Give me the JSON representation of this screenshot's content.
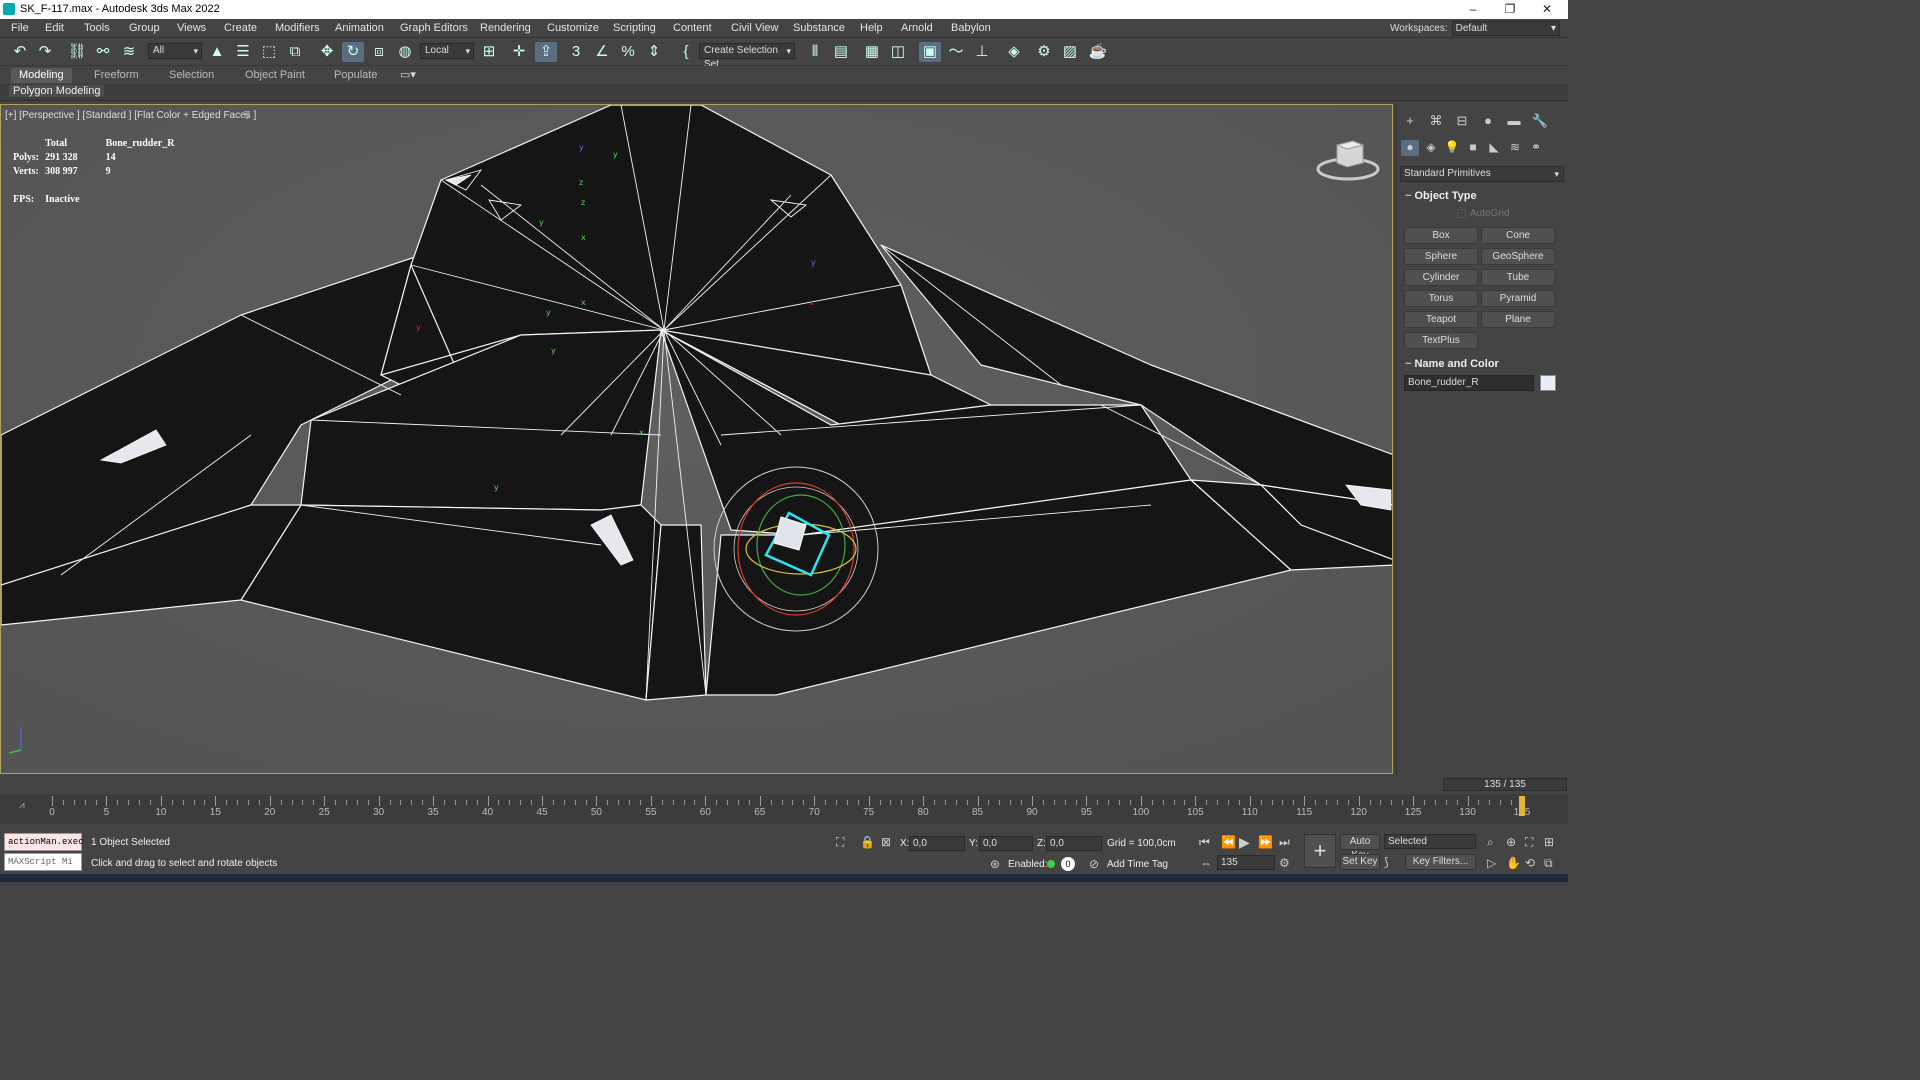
{
  "titlebar": {
    "title": "SK_F-117.max - Autodesk 3ds Max 2022",
    "minimize": "–",
    "restore": "❐",
    "close": "✕"
  },
  "menu": [
    "File",
    "Edit",
    "Tools",
    "Group",
    "Views",
    "Create",
    "Modifiers",
    "Animation",
    "Graph Editors",
    "Rendering",
    "Customize",
    "Scripting",
    "Content",
    "Civil View",
    "Substance",
    "Help",
    "Arnold",
    "Babylon"
  ],
  "workspace": {
    "label": "Workspaces:",
    "value": "Default"
  },
  "toolbar": {
    "filter": "All",
    "coord": "Local",
    "selset": "Create Selection Set"
  },
  "ribbon": {
    "tabs": [
      "Modeling",
      "Freeform",
      "Selection",
      "Object Paint",
      "Populate"
    ],
    "sub": "Polygon Modeling"
  },
  "viewport": {
    "label": "[+] [Perspective ] [Standard ] [Flat Color + Edged Faces ]",
    "stats": {
      "total": "Total",
      "object": "Bone_rudder_R",
      "polys_label": "Polys:",
      "polys_total": "291 328",
      "polys_obj": "14",
      "verts_label": "Verts:",
      "verts_total": "308 997",
      "verts_obj": "9",
      "fps_label": "FPS:",
      "fps_value": "Inactive"
    }
  },
  "cmdpanel": {
    "primitives": "Standard Primitives",
    "object_type": "Object Type",
    "autogrid": "AutoGrid",
    "buttons": [
      "Box",
      "Cone",
      "Sphere",
      "GeoSphere",
      "Cylinder",
      "Tube",
      "Torus",
      "Pyramid",
      "Teapot",
      "Plane",
      "TextPlus"
    ],
    "name_color": "Name and Color",
    "name": "Bone_rudder_R"
  },
  "time": {
    "frame": "135 / 135",
    "ticks": [
      "0",
      "5",
      "10",
      "15",
      "20",
      "25",
      "30",
      "35",
      "40",
      "45",
      "50",
      "55",
      "60",
      "65",
      "70",
      "75",
      "80",
      "85",
      "90",
      "95",
      "100",
      "105",
      "110",
      "115",
      "120",
      "125",
      "130",
      "135"
    ]
  },
  "status": {
    "maxscript1": "actionMan.exec",
    "maxscript2": "MAXScript Mi",
    "selected": "1 Object Selected",
    "prompt": "Click and drag to select and rotate objects",
    "x_label": "X:",
    "x_val": "0,0",
    "y_label": "Y:",
    "y_val": "0,0",
    "z_label": "Z:",
    "z_val": "0,0",
    "grid": "Grid = 100,0cm",
    "enabled": "Enabled:",
    "enabled_val": "0",
    "timetag": "Add Time Tag",
    "autokey": "Auto Key",
    "setkey": "Set Key",
    "selected_dd": "Selected",
    "keyfilters": "Key Filters...",
    "curframe": "135"
  }
}
